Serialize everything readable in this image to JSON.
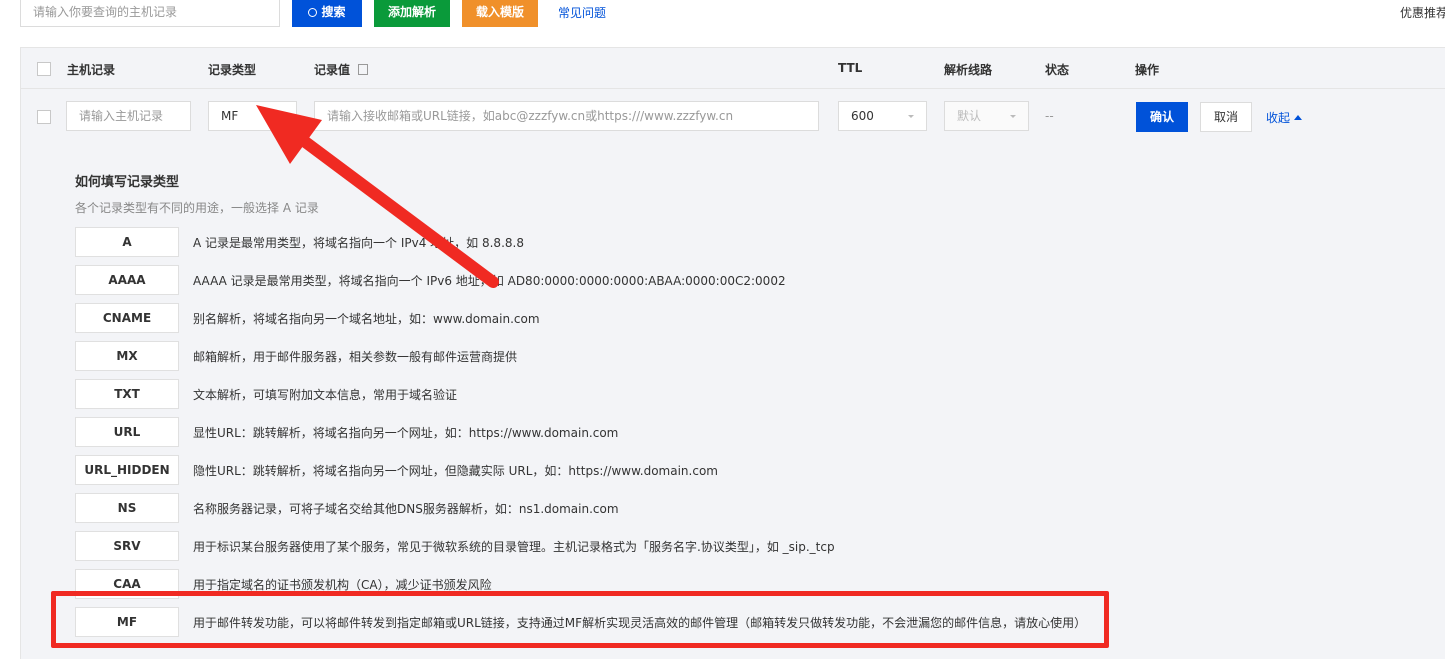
{
  "toolbar": {
    "search_placeholder": "请输入你要查询的主机记录",
    "search_button": "搜索",
    "add_button": "添加解析",
    "template_button": "载入模版",
    "faq_link": "常见问题",
    "promo_link": "优惠推荐"
  },
  "table": {
    "headers": {
      "host": "主机记录",
      "type": "记录类型",
      "value": "记录值",
      "ttl": "TTL",
      "line": "解析线路",
      "status": "状态",
      "action": "操作"
    },
    "edit_row": {
      "host_placeholder": "请输入主机记录",
      "type_value": "MF",
      "value_placeholder": "请输入接收邮箱或URL链接，如abc@zzzfyw.cn或https:///www.zzzfyw.cn",
      "ttl_value": "600",
      "line_value": "默认",
      "status": "--",
      "confirm": "确认",
      "cancel": "取消",
      "collapse": "收起"
    }
  },
  "help": {
    "title": "如何填写记录类型",
    "subtitle": "各个记录类型有不同的用途，一般选择 A 记录",
    "types": [
      {
        "name": "A",
        "desc": "A 记录是最常用类型，将域名指向一个 IPv4 地址，如 8.8.8.8"
      },
      {
        "name": "AAAA",
        "desc": "AAAA 记录是最常用类型，将域名指向一个 IPv6 地址，如 AD80:0000:0000:0000:ABAA:0000:00C2:0002"
      },
      {
        "name": "CNAME",
        "desc": "别名解析，将域名指向另一个域名地址，如：www.domain.com"
      },
      {
        "name": "MX",
        "desc": "邮箱解析，用于邮件服务器，相关参数一般有邮件运营商提供"
      },
      {
        "name": "TXT",
        "desc": "文本解析，可填写附加文本信息，常用于域名验证"
      },
      {
        "name": "URL",
        "desc": "显性URL：跳转解析，将域名指向另一个网址，如：https://www.domain.com"
      },
      {
        "name": "URL_HIDDEN",
        "desc": "隐性URL：跳转解析，将域名指向另一个网址，但隐藏实际 URL，如：https://www.domain.com"
      },
      {
        "name": "NS",
        "desc": "名称服务器记录，可将子域名交给其他DNS服务器解析，如：ns1.domain.com"
      },
      {
        "name": "SRV",
        "desc": "用于标识某台服务器使用了某个服务，常见于微软系统的目录管理。主机记录格式为「服务名字.协议类型」，如 _sip._tcp"
      },
      {
        "name": "CAA",
        "desc": "用于指定域名的证书颁发机构（CA），减少证书颁发风险"
      },
      {
        "name": "MF",
        "desc": "用于邮件转发功能，可以将邮件转发到指定邮箱或URL链接，支持通过MF解析实现灵活高效的邮件管理（邮箱转发只做转发功能，不会泄漏您的邮件信息，请放心使用）"
      }
    ]
  },
  "colors": {
    "primary": "#0052d9",
    "add_green": "#0a9a3a",
    "template_orange": "#f0902a",
    "annotation_red": "#f02a22"
  }
}
